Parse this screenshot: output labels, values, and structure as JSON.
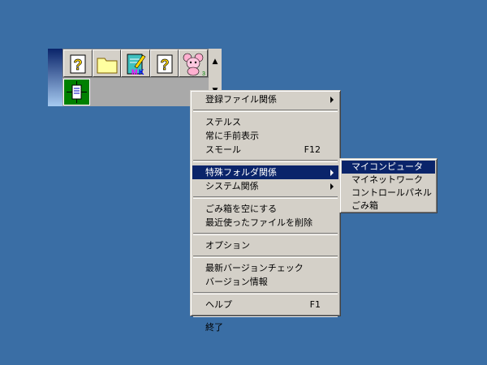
{
  "launcher": {
    "buttons": [
      {
        "icon": "help-icon"
      },
      {
        "icon": "folder-icon"
      },
      {
        "icon": "notepad-icon",
        "badge": "MK"
      },
      {
        "icon": "help-icon"
      },
      {
        "icon": "mouse-character-icon"
      }
    ],
    "row2": [
      {
        "icon": "green-app-icon"
      }
    ],
    "scroll_up": "▲",
    "scroll_down": "▼"
  },
  "main_menu": {
    "groups": [
      [
        {
          "label": "登録ファイル関係",
          "submenu": true
        }
      ],
      [
        {
          "label": "ステルス"
        },
        {
          "label": "常に手前表示"
        },
        {
          "label": "スモール",
          "shortcut": "F12"
        }
      ],
      [
        {
          "label": "特殊フォルダ関係",
          "submenu": true,
          "highlighted": true
        },
        {
          "label": "システム関係",
          "submenu": true
        }
      ],
      [
        {
          "label": "ごみ箱を空にする"
        },
        {
          "label": "最近使ったファイルを削除"
        }
      ],
      [
        {
          "label": "オプション"
        }
      ],
      [
        {
          "label": "最新バージョンチェック"
        },
        {
          "label": "バージョン情報"
        }
      ],
      [
        {
          "label": "ヘルプ",
          "shortcut": "F1"
        }
      ],
      [
        {
          "label": "終了"
        }
      ]
    ]
  },
  "sub_menu": {
    "items": [
      {
        "label": "マイコンピュータ",
        "highlighted": true
      },
      {
        "label": "マイネットワーク"
      },
      {
        "label": "コントロールパネル"
      },
      {
        "label": "ごみ箱"
      }
    ]
  },
  "colors": {
    "desktop": "#3a6ea5",
    "highlight": "#0a246a",
    "face": "#d4d0c8"
  }
}
